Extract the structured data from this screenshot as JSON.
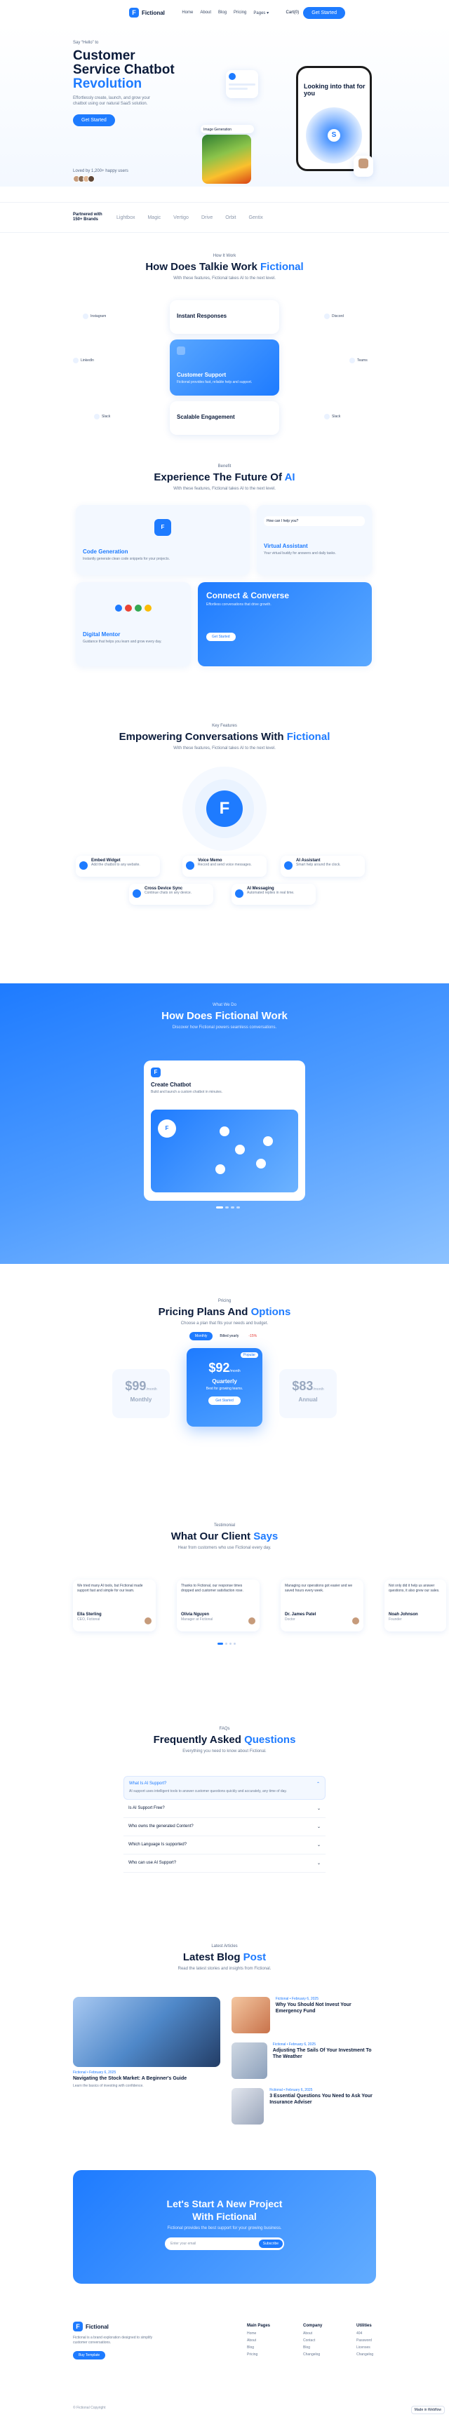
{
  "header": {
    "brand": "Fictional",
    "nav": [
      "Home",
      "About",
      "Blog",
      "Pricing",
      "Pages ▾"
    ],
    "cart": "Cart(0)",
    "cta": "Get Started"
  },
  "hero": {
    "tag": "Say “Hello” to",
    "title_1": "Customer",
    "title_2": "Service Chatbot",
    "title_3": "Revolution",
    "desc": "Effortlessly create, launch, and grow your chatbot using our natural SaaS solution.",
    "button": "Get Started",
    "users_text": "Loved by 1,200+ happy users",
    "phone_title": "Looking into that for you",
    "image_caption": "Image Generation"
  },
  "partners": {
    "label": "Partnered with 150+ Brands",
    "logos": [
      "Lightbox",
      "Magic",
      "Vertigo",
      "Drive",
      "Orbit",
      "Gentix"
    ]
  },
  "how": {
    "tag": "How It Work",
    "title_a": "How Does Talkie Work ",
    "title_b": "Fictional",
    "sub": "With these features, Fictional takes AI to the next level.",
    "items": [
      "Instant Responses",
      "Customer Support",
      "Scalable Engagement"
    ],
    "active_desc": "Fictional provides fast, reliable help and support.",
    "left": [
      "Instagram",
      "LinkedIn",
      "Slack"
    ],
    "right": [
      "Discord",
      "Teams",
      "Slack"
    ]
  },
  "experience": {
    "tag": "Benefit",
    "title_a": "Experience The Future Of ",
    "title_b": "AI",
    "sub": "With these features, Fictional takes AI to the next level.",
    "cards": [
      {
        "title": "Code Generation",
        "desc": "Instantly generate clean code snippets for your projects."
      },
      {
        "title": "Virtual Assistant",
        "desc": "Your virtual buddy for answers and daily tasks."
      },
      {
        "title": "Digital Mentor",
        "desc": "Guidance that helps you learn and grow every day."
      },
      {
        "title": "Connect & Converse",
        "desc": "Effortless conversations that drive growth.",
        "button": "Get Started"
      }
    ],
    "assistant_msg": "How can I help you?"
  },
  "empowering": {
    "tag": "Key Features",
    "title_a": "Empowering Conversations With ",
    "title_b": "Fictional",
    "sub": "With these features, Fictional takes AI to the next level.",
    "features": [
      {
        "title": "Embed Widget",
        "desc": "Add the chatbot to any website."
      },
      {
        "title": "Voice Memo",
        "desc": "Record and send voice messages."
      },
      {
        "title": "AI Assistant",
        "desc": "Smart help around the clock."
      },
      {
        "title": "Cross Device Sync",
        "desc": "Continue chats on any device."
      },
      {
        "title": "AI Messaging",
        "desc": "Automated replies in real time."
      }
    ]
  },
  "whatwedo": {
    "tag": "What We Do",
    "title": "How Does Fictional Work",
    "sub": "Discover how Fictional powers seamless conversations.",
    "card_title": "Create Chatbot",
    "card_desc": "Build and launch a custom chatbot in minutes."
  },
  "pricing": {
    "tag": "Pricing",
    "title_a": "Pricing Plans And ",
    "title_b": "Options",
    "sub": "Choose a plan that fits your needs and budget.",
    "toggle_on": "Monthly",
    "toggle_off": "Billed yearly",
    "discount": "-15%",
    "plans": [
      {
        "price": "$99",
        "per": "/month",
        "name": "Monthly"
      },
      {
        "price": "$92",
        "per": "/month",
        "name": "Quarterly",
        "desc": "Best for growing teams.",
        "button": "Get Started",
        "badge": "Popular"
      },
      {
        "price": "$83",
        "per": "/month",
        "name": "Annual"
      }
    ]
  },
  "testimonials": {
    "tag": "Testimonial",
    "title_a": "What Our Client ",
    "title_b": "Says",
    "sub": "Hear from customers who use Fictional every day.",
    "items": [
      {
        "quote": "We tried many AI tools, but Fictional made support fast and simple for our team.",
        "name": "Ella Sterling",
        "role": "CEO, Fictional"
      },
      {
        "quote": "Thanks to Fictional, our response times dropped and customer satisfaction rose.",
        "name": "Olivia Nguyen",
        "role": "Manager at Fictional"
      },
      {
        "quote": "Managing our operations got easier and we saved hours every week.",
        "name": "Dr. James Patel",
        "role": "Doctor"
      },
      {
        "quote": "Not only did it help us answer questions, it also grew our sales.",
        "name": "Noah Johnson",
        "role": "Founder"
      }
    ]
  },
  "faq": {
    "tag": "FAQs",
    "title_a": "Frequently Asked ",
    "title_b": "Questions",
    "sub": "Everything you need to know about Fictional.",
    "open_q": "What Is AI Support?",
    "open_a": "AI support uses intelligent tools to answer customer questions quickly and accurately, any time of day.",
    "items": [
      "Is AI Support Free?",
      "Who owns the generated Content?",
      "Which Language Is supported?",
      "Who can use AI Support?"
    ]
  },
  "blog": {
    "tag": "Latest Articles",
    "title_a": "Latest Blog ",
    "title_b": "Post",
    "sub": "Read the latest stories and insights from Fictional.",
    "big": {
      "meta": "Fictional • February 6, 2025",
      "title": "Navigating the Stock Market: A Beginner's Guide",
      "desc": "Learn the basics of investing with confidence."
    },
    "items": [
      {
        "meta": "Fictional • February 6, 2025",
        "title": "Why You Should Not Invest Your Emergency Fund"
      },
      {
        "meta": "Fictional • February 6, 2025",
        "title": "Adjusting The Sails Of Your Investment To The Weather"
      },
      {
        "meta": "Fictional • February 6, 2025",
        "title": "3 Essential Questions You Need to Ask Your Insurance Adviser"
      }
    ]
  },
  "cta": {
    "title_1": "Let's Start A New Project",
    "title_2": "With Fictional",
    "desc": "Fictional provides the best support for your growing business.",
    "placeholder": "Enter your email",
    "button": "Subscribe"
  },
  "footer": {
    "brand": "Fictional",
    "desc": "Fictional is a brand exploration designed to simplify customer conversations.",
    "button": "Buy Template",
    "cols": [
      {
        "h": "Main Pages",
        "items": [
          "Home",
          "About",
          "Blog",
          "Pricing"
        ]
      },
      {
        "h": "Company",
        "items": [
          "About",
          "Contact",
          "Blog",
          "Changelog"
        ]
      },
      {
        "h": "Utilities",
        "items": [
          "404",
          "Password",
          "Licenses",
          "Changelog"
        ]
      }
    ],
    "copyright": "© Fictional Copyright",
    "made": "Made in Webflow"
  }
}
